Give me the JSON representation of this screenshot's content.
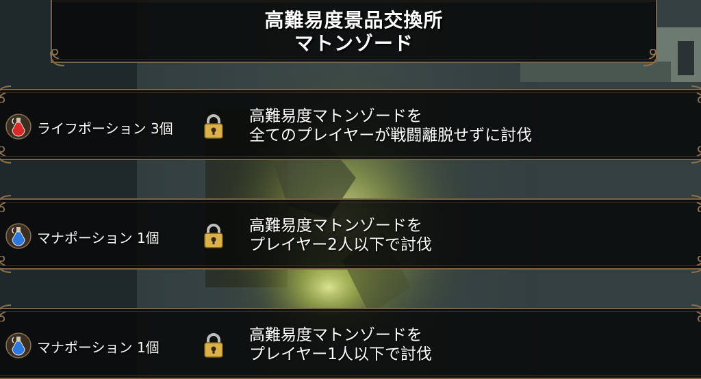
{
  "header": {
    "title_line1": "高難易度景品交換所",
    "title_line2": "マトンゾード"
  },
  "rewards": [
    {
      "potion": "life-potion-icon",
      "potion_color": "#d82a2a",
      "label": "ライフポーション 3個",
      "condition_line1": "高難易度マトンゾードを",
      "condition_line2": "全てのプレイヤーが戦闘離脱せずに討伐",
      "locked": true
    },
    {
      "potion": "mana-potion-icon",
      "potion_color": "#2a78e0",
      "label": "マナポーション 1個",
      "condition_line1": "高難易度マトンゾードを",
      "condition_line2": "プレイヤー2人以下で討伐",
      "locked": true
    },
    {
      "potion": "mana-potion-icon",
      "potion_color": "#2a78e0",
      "label": "マナポーション 1個",
      "condition_line1": "高難易度マトンゾードを",
      "condition_line2": "プレイヤー1人以下で討伐",
      "locked": true
    }
  ],
  "colors": {
    "frame": "#7a6448",
    "lock_gold": "#d9b24a",
    "glow": "#c9d46a"
  }
}
